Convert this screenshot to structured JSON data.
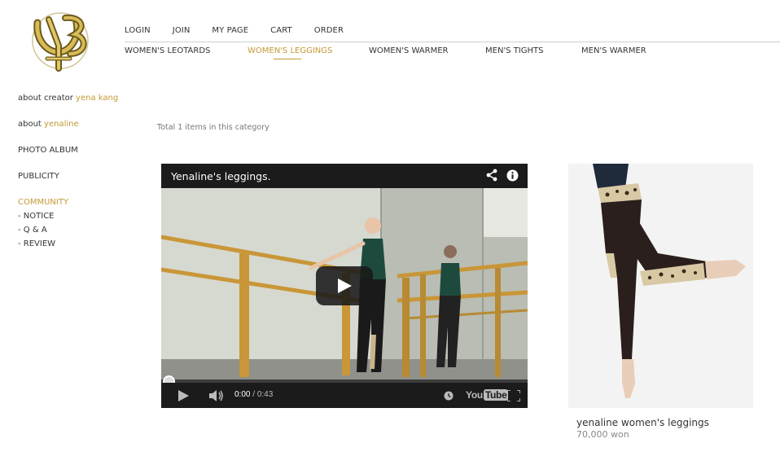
{
  "brand": {
    "logo_text": "YNB",
    "accent": "#c49a35"
  },
  "top_nav": [
    {
      "label": "LOGIN"
    },
    {
      "label": "JOIN"
    },
    {
      "label": "MY PAGE"
    },
    {
      "label": "CART"
    },
    {
      "label": "ORDER"
    }
  ],
  "category_nav": [
    {
      "label": "WOMEN'S LEOTARDS",
      "active": false
    },
    {
      "label": "WOMEN'S LEGGINGS",
      "active": true
    },
    {
      "label": "WOMEN'S WARMER",
      "active": false
    },
    {
      "label": "MEN'S TIGHTS",
      "active": false
    },
    {
      "label": "MEN'S WARMER",
      "active": false
    }
  ],
  "sidebar": {
    "about_creator_prefix": "about creator",
    "about_creator_name": "yena kang",
    "about_prefix": "about",
    "about_name": "yenaline",
    "photo_album": "PHOTO ALBUM",
    "publicity": "PUBLICITY",
    "community": "COMMUNITY",
    "notice": "- NOTICE",
    "qa": "- Q & A",
    "review": "- REVIEW"
  },
  "listing": {
    "total_text": "Total 1 items in this category"
  },
  "video": {
    "title": "Yenaline's leggings.",
    "current_time": "0:00",
    "separator": " / ",
    "duration": "0:43",
    "logo_you": "You",
    "logo_tube": "Tube",
    "icons": [
      "share-icon",
      "info-icon",
      "play-icon",
      "volume-icon",
      "clock-icon",
      "fullscreen-icon"
    ]
  },
  "product": {
    "name": "yenaline women's leggings",
    "price": "70,000 won"
  }
}
